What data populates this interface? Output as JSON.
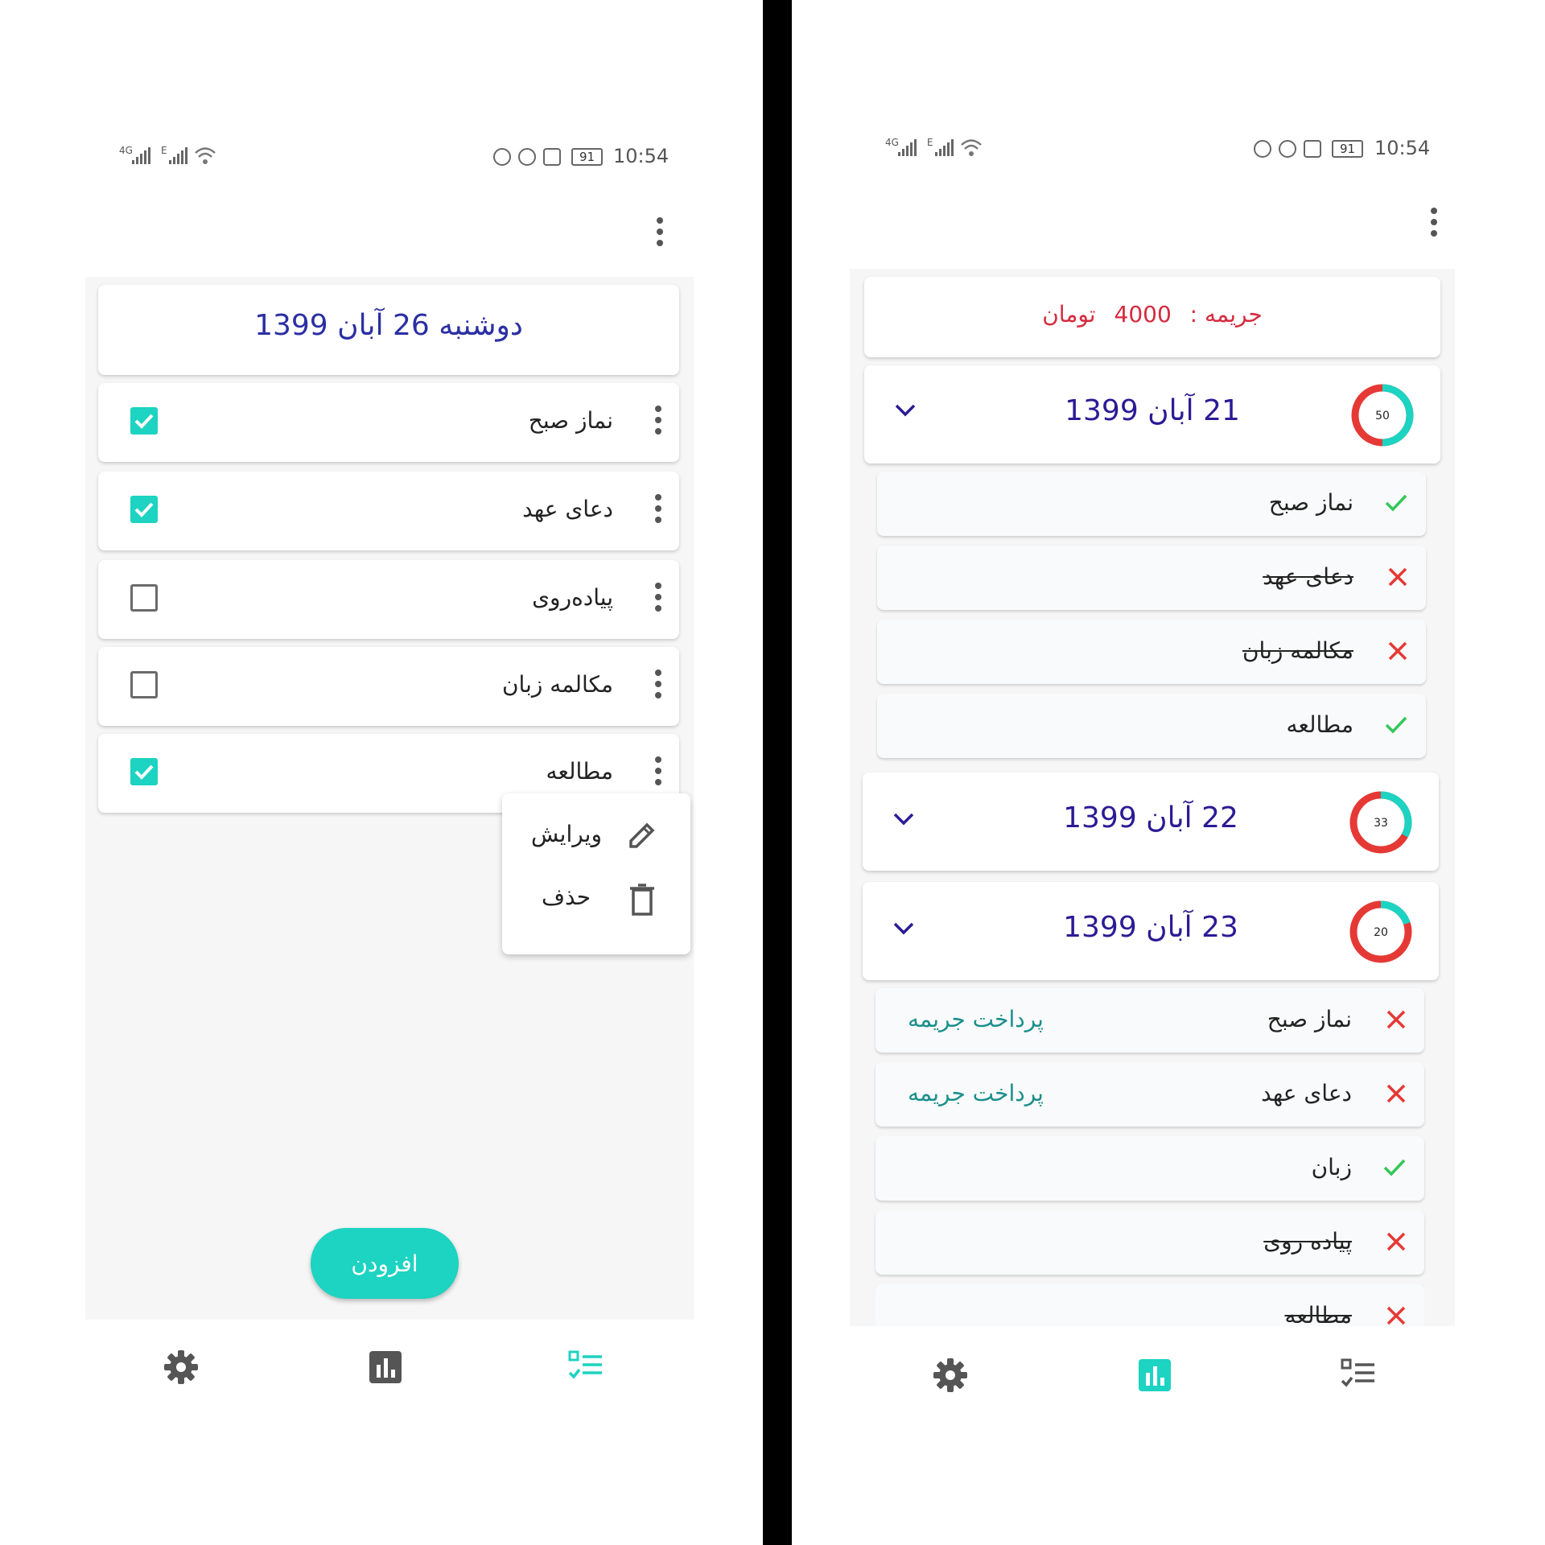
{
  "left": {
    "status": {
      "left_network": [
        "4G",
        "E"
      ],
      "time": "10:54",
      "battery": "91"
    },
    "header_date": "دوشنبه 26 آبان 1399",
    "tasks": [
      {
        "label": "نماز صبح",
        "checked": true
      },
      {
        "label": "دعای عهد",
        "checked": true
      },
      {
        "label": "پیاده‌روی",
        "checked": false
      },
      {
        "label": "مکالمه زبان",
        "checked": false
      },
      {
        "label": "مطالعه",
        "checked": true
      }
    ],
    "context_menu": {
      "edit": "ویرایش",
      "delete": "حذف"
    },
    "add_button": "افزودن",
    "nav": [
      "gear-icon",
      "bar-chart-icon",
      "checklist-icon"
    ],
    "nav_active": 2
  },
  "right": {
    "status": {
      "left_network": [
        "4G",
        "E"
      ],
      "time": "10:54",
      "battery": "91"
    },
    "fine": {
      "label": "جریمه :",
      "amount": "4000",
      "unit": "تومان"
    },
    "days": [
      {
        "date": "21 آبان 1399",
        "percent": 50,
        "percent_label": "50"
      },
      {
        "date": "22 آبان 1399",
        "percent": 33,
        "percent_label": "33"
      },
      {
        "date": "23 آبان 1399",
        "percent": 20,
        "percent_label": "20"
      }
    ],
    "day1_items": [
      {
        "label": "نماز صبح",
        "done": true
      },
      {
        "label": "دعای عهد",
        "done": false
      },
      {
        "label": "مکالمه زبان",
        "done": false
      },
      {
        "label": "مطالعه",
        "done": true
      }
    ],
    "day3_items": [
      {
        "label": "نماز صبح",
        "done": false,
        "action": "پرداخت جریمه"
      },
      {
        "label": "دعای عهد",
        "done": false,
        "action": "پرداخت جریمه"
      },
      {
        "label": "زبان",
        "done": true
      },
      {
        "label": "پیاده روی",
        "done": false
      },
      {
        "label": "مطالعه",
        "done": false
      }
    ],
    "nav": [
      "gear-icon",
      "bar-chart-icon",
      "checklist-icon"
    ],
    "nav_active": 1
  },
  "colors": {
    "accent": "#1dd3c1",
    "date_blue": "#2b2fa3",
    "fine_red": "#d52b3f",
    "fail_red": "#e53935",
    "ok_green": "#34c759",
    "pay_teal": "#1a8f8c"
  }
}
